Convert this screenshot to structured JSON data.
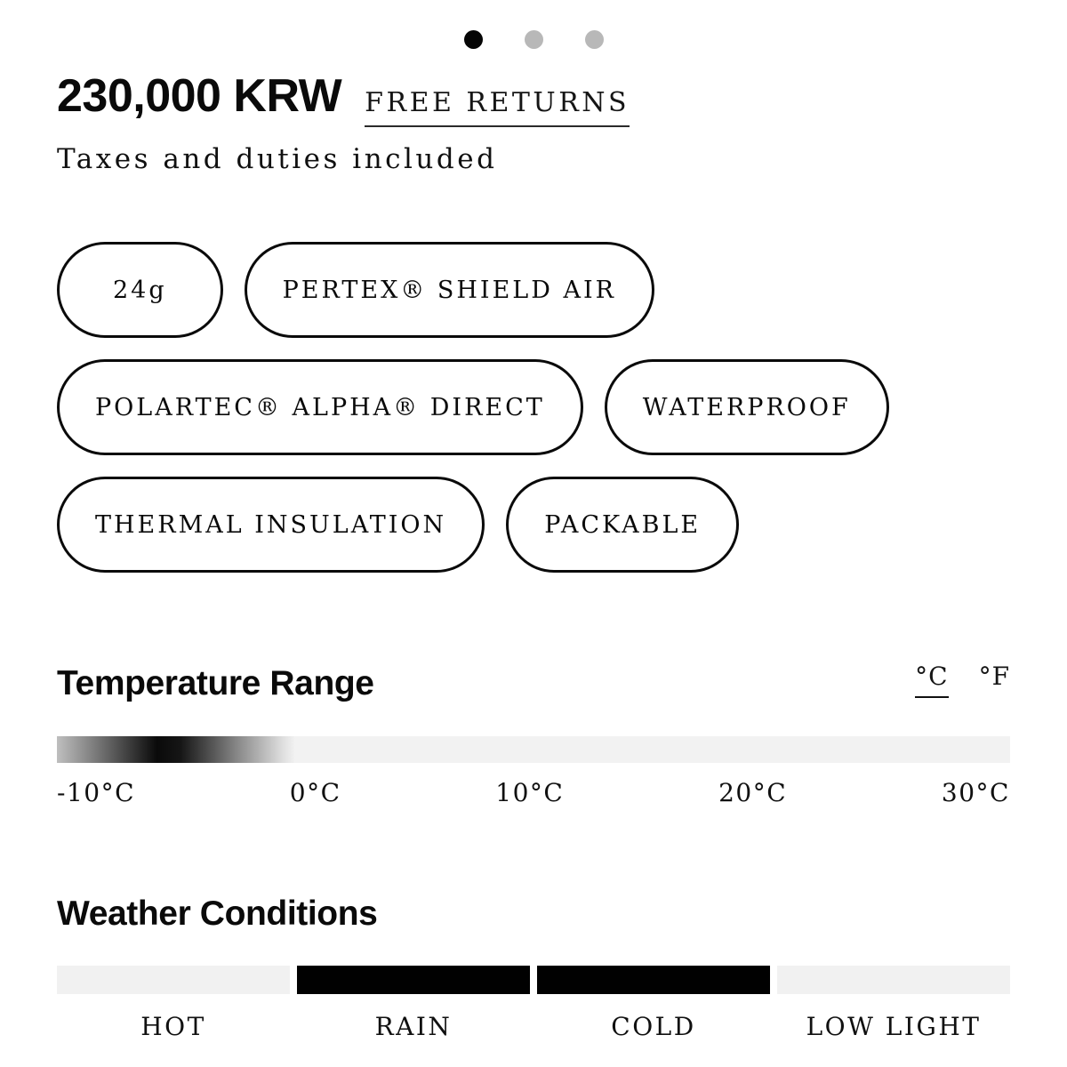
{
  "carousel": {
    "dots": [
      {
        "name": "dot-1",
        "active": true
      },
      {
        "name": "dot-2",
        "active": false
      },
      {
        "name": "dot-3",
        "active": false
      }
    ]
  },
  "price": {
    "amount": "230,000 KRW",
    "returns_label": "FREE RETURNS",
    "taxes_note": "Taxes and duties included"
  },
  "features": [
    {
      "label": "24g"
    },
    {
      "label": "PERTEX® SHIELD AIR"
    },
    {
      "label": "POLARTEC® ALPHA® DIRECT"
    },
    {
      "label": "WATERPROOF"
    },
    {
      "label": "THERMAL INSULATION"
    },
    {
      "label": "PACKABLE"
    }
  ],
  "temperature": {
    "title": "Temperature Range",
    "units": [
      {
        "label": "°C",
        "active": true
      },
      {
        "label": "°F",
        "active": false
      }
    ],
    "ticks": [
      "-10°C",
      "0°C",
      "10°C",
      "20°C",
      "30°C"
    ],
    "range_min": "-10",
    "range_max": "30",
    "fill_start_pct": 0,
    "fill_end_pct": 25,
    "track_color": "#f2f2f2",
    "fill_color": "#0a0a0a"
  },
  "weather": {
    "title": "Weather Conditions",
    "conditions": [
      {
        "label": "HOT",
        "active": false
      },
      {
        "label": "RAIN",
        "active": true
      },
      {
        "label": "COLD",
        "active": true
      },
      {
        "label": "LOW LIGHT",
        "active": false
      }
    ],
    "active_color": "#010101",
    "inactive_color": "#f1f1f1"
  },
  "chart_data": {
    "type": "bar",
    "title": "Weather Conditions",
    "categories": [
      "HOT",
      "RAIN",
      "COLD",
      "LOW LIGHT"
    ],
    "values": [
      0,
      1,
      1,
      0
    ],
    "xlabel": "",
    "ylabel": "",
    "ylim": [
      0,
      1
    ]
  }
}
